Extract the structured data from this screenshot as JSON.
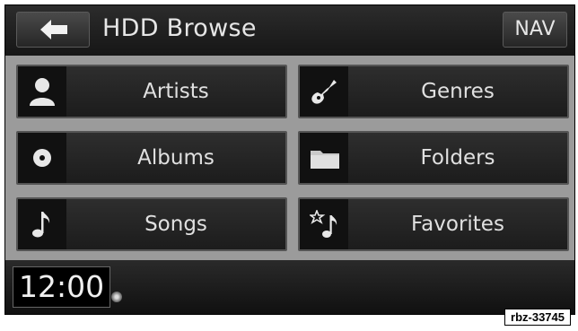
{
  "header": {
    "back_icon": "back-arrow-icon",
    "title": "HDD Browse",
    "nav_label": "NAV"
  },
  "tiles": [
    {
      "label": "Artists",
      "icon": "person-icon"
    },
    {
      "label": "Genres",
      "icon": "guitar-icon"
    },
    {
      "label": "Albums",
      "icon": "disc-icon"
    },
    {
      "label": "Folders",
      "icon": "folder-icon"
    },
    {
      "label": "Songs",
      "icon": "music-note-icon"
    },
    {
      "label": "Favorites",
      "icon": "star-note-icon"
    }
  ],
  "status": {
    "clock": "12:00"
  },
  "figure_id": "rbz-33745",
  "colors": {
    "background": "#000000",
    "tile_area": "#9b9b9b",
    "text": "#e0e0e0"
  }
}
